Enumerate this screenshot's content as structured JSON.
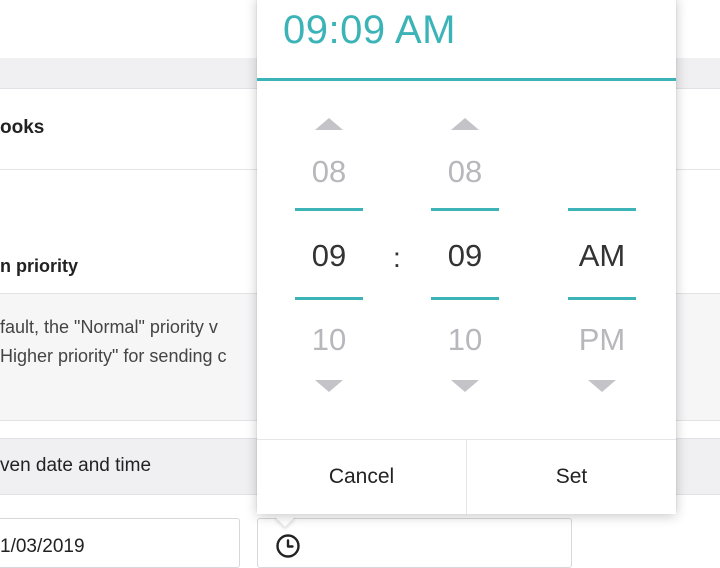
{
  "background": {
    "section_title": "ooks",
    "priority_title": "n priority",
    "description_line1": "fault, the \"Normal\" priority v",
    "description_line2": "Higher priority\" for sending c",
    "datetime_label": "ven date and time",
    "date_value": "1/03/2019"
  },
  "time_picker": {
    "display_time": "09:09 AM",
    "hour": {
      "prev": "08",
      "current": "09",
      "next": "10"
    },
    "minute": {
      "prev": "08",
      "current": "09",
      "next": "10"
    },
    "separator": ":",
    "period": {
      "current": "AM",
      "next": "PM"
    },
    "cancel_label": "Cancel",
    "set_label": "Set"
  },
  "colors": {
    "accent": "#3bb3b7"
  },
  "icons": {
    "time_input": "clock-icon"
  }
}
